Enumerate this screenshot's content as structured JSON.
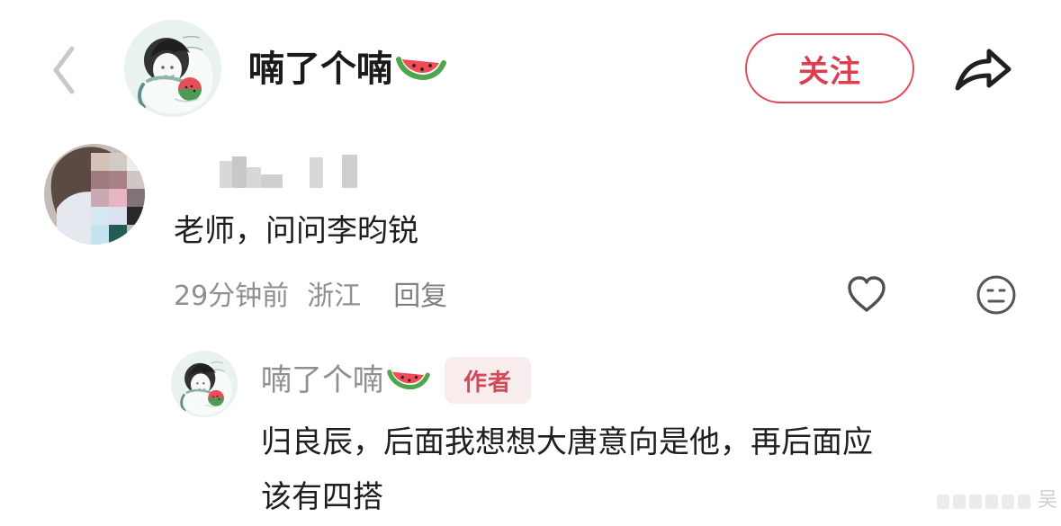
{
  "header": {
    "back_icon": "back-chevron-icon",
    "avatar_icon": "profile-avatar-icon",
    "username": "喃了个喃",
    "name_emoji": "watermelon-icon",
    "follow_label": "关注",
    "share_icon": "share-icon"
  },
  "comment": {
    "avatar_icon": "pixelated-avatar-icon",
    "username_blurred_icon": "blurred-username-icon",
    "text": "老师，问问李昀锐",
    "time": "29分钟前",
    "location": "浙江",
    "reply_label": "回复",
    "like_icon": "heart-icon",
    "emoji_icon": "neutral-face-icon"
  },
  "reply": {
    "avatar_icon": "profile-avatar-icon",
    "username": "喃了个喃",
    "name_emoji": "watermelon-icon",
    "badge": "作者",
    "text_line_1": "归良辰，后面我想想大唐意向是他，再后面应",
    "text_line_2": "该有四搭"
  },
  "colors": {
    "accent_red": "#e14a59",
    "text_dark": "#1e1e1e",
    "text_gray": "#8f8f8f",
    "badge_bg": "#f9ecec",
    "avatar_bg": "#e8f1ef"
  }
}
